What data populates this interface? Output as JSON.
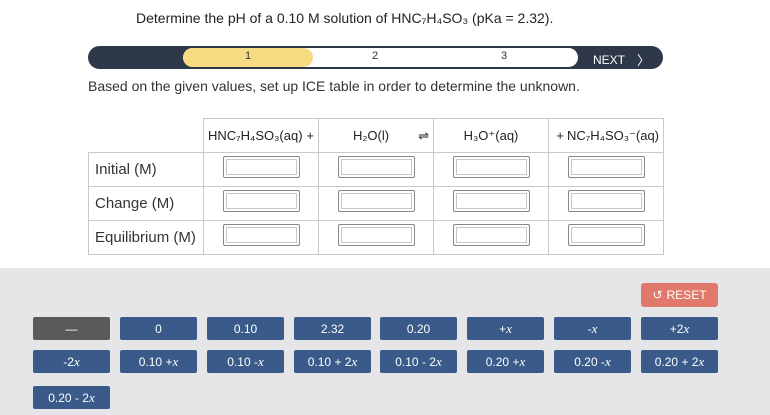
{
  "question": "Determine the pH of a 0.10 M solution of HNC₇H₄SO₃ (pKa = 2.32).",
  "progress": {
    "steps": [
      "1",
      "2",
      "3"
    ],
    "active_step": 1,
    "next_label": "NEXT",
    "next_icon": "chevron-right-icon"
  },
  "instruction": "Based on the given values, set up ICE table in order to determine the unknown.",
  "table": {
    "headers": [
      {
        "species": "HNC₇H₄SO₃(aq)",
        "sign": "+"
      },
      {
        "species": "H₂O(l)",
        "sign": "⇌"
      },
      {
        "species": "H₃O⁺(aq)",
        "sign": "+"
      },
      {
        "species": "NC₇H₄SO₃⁻(aq)",
        "sign": ""
      }
    ],
    "rows": [
      "Initial (M)",
      "Change (M)",
      "Equilibrium (M)"
    ],
    "input_values": [
      [
        "",
        "",
        "",
        ""
      ],
      [
        "",
        "",
        "",
        ""
      ],
      [
        "",
        "",
        "",
        ""
      ]
    ]
  },
  "keypad": {
    "reset_label": "RESET",
    "reset_icon": "undo-icon",
    "colors": {
      "key": "#3a5a8a",
      "key_dark": "#5a5a5a",
      "reset": "#e0796b"
    },
    "keys": [
      [
        "—",
        "0",
        "0.10",
        "2.32",
        "0.20",
        "+x",
        "-x",
        "+2x"
      ],
      [
        "-2x",
        "0.10 + x",
        "0.10 - x",
        "0.10 + 2x",
        "0.10 - 2x",
        "0.20 + x",
        "0.20 - x",
        "0.20 + 2x"
      ],
      [
        "0.20 - 2x"
      ]
    ]
  }
}
